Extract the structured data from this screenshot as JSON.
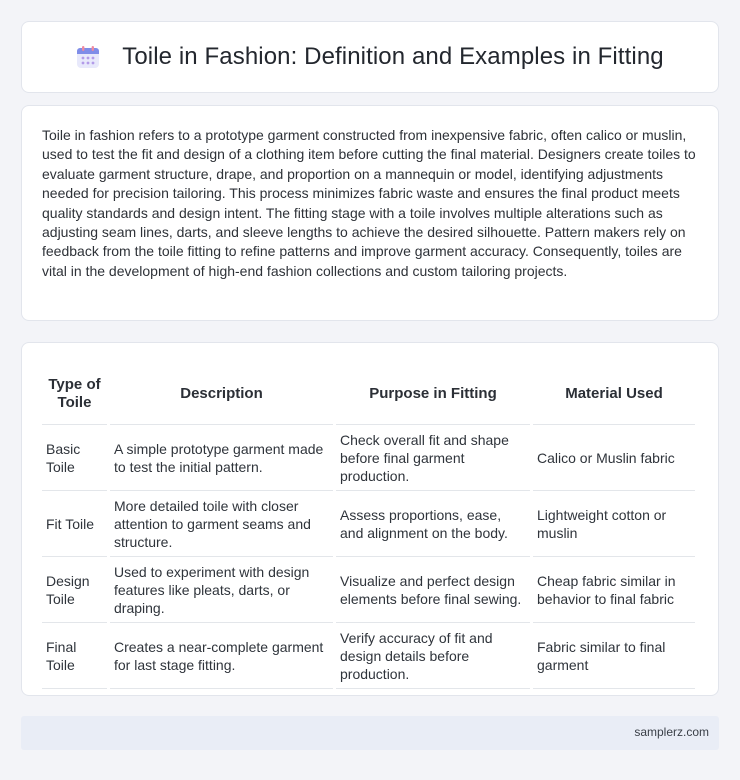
{
  "header": {
    "title": "Toile in Fashion: Definition and Examples in Fitting",
    "icon": "calendar-icon"
  },
  "intro": {
    "text": "Toile in fashion refers to a prototype garment constructed from inexpensive fabric, often calico or muslin, used to test the fit and design of a clothing item before cutting the final material. Designers create toiles to evaluate garment structure, drape, and proportion on a mannequin or model, identifying adjustments needed for precision tailoring. This process minimizes fabric waste and ensures the final product meets quality standards and design intent. The fitting stage with a toile involves multiple alterations such as adjusting seam lines, darts, and sleeve lengths to achieve the desired silhouette. Pattern makers rely on feedback from the toile fitting to refine patterns and improve garment accuracy. Consequently, toiles are vital in the development of high-end fashion collections and custom tailoring projects."
  },
  "table": {
    "headers": [
      "Type of Toile",
      "Description",
      "Purpose in Fitting",
      "Material Used"
    ],
    "rows": [
      [
        "Basic Toile",
        "A simple prototype garment made to test the initial pattern.",
        "Check overall fit and shape before final garment production.",
        "Calico or Muslin fabric"
      ],
      [
        "Fit Toile",
        "More detailed toile with closer attention to garment seams and structure.",
        "Assess proportions, ease, and alignment on the body.",
        "Lightweight cotton or muslin"
      ],
      [
        "Design Toile",
        "Used to experiment with design features like pleats, darts, or draping.",
        "Visualize and perfect design elements before final sewing.",
        "Cheap fabric similar in behavior to final fabric"
      ],
      [
        "Final Toile",
        "Creates a near-complete garment for last stage fitting.",
        "Verify accuracy of fit and design details before production.",
        "Fabric similar to final garment"
      ]
    ]
  },
  "footer": {
    "site": "samplerz.com"
  },
  "colors": {
    "background": "#f3f4f8",
    "card": "#ffffff",
    "footer": "#e9edf6",
    "icon_accent": "#6f7fe6"
  }
}
